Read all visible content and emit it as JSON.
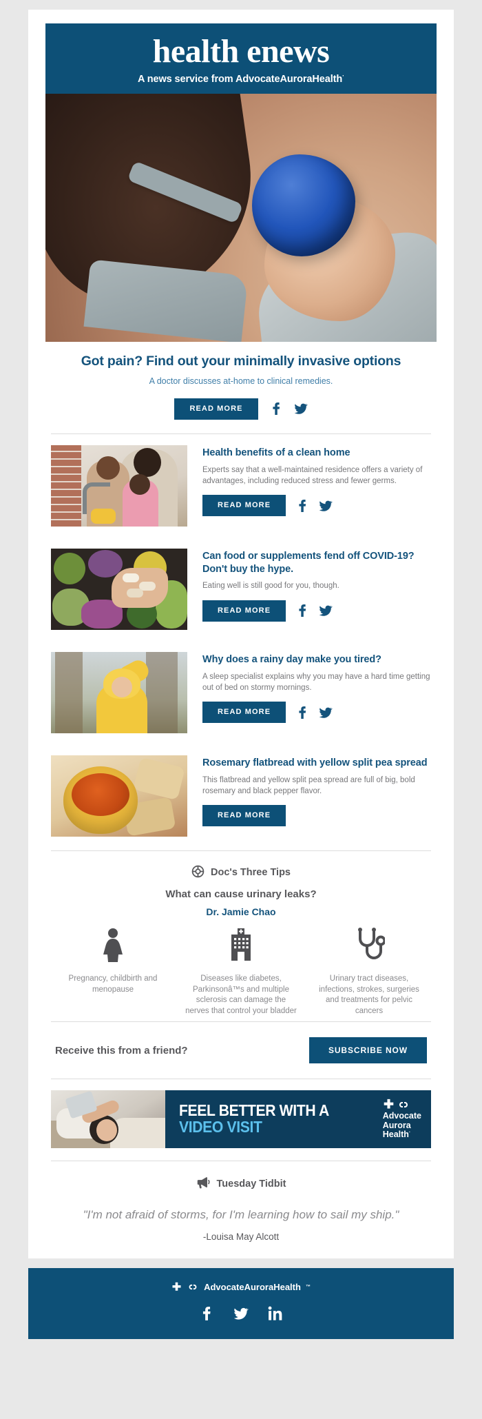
{
  "masthead": {
    "title": "health enews",
    "subtitle_prefix": "A news service from ",
    "brand": "AdvocateAuroraHealth",
    "tm": "·",
    "hero_image_alt": "woman-holding-ice-pack-to-shoulder"
  },
  "lead": {
    "title": "Got pain? Find out your minimally invasive options",
    "subtitle": "A doctor discusses at-home to clinical remedies.",
    "read_more": "READ MORE",
    "facebook": "facebook-icon",
    "twitter": "twitter-icon"
  },
  "articles": [
    {
      "title": "Health benefits of a clean home",
      "desc": "Experts say that a well-maintained residence offers a variety of advantages, including reduced stress and fewer germs.",
      "read_more": "READ MORE",
      "image_alt": "family-washing-dishes-at-kitchen-sink",
      "has_social": true
    },
    {
      "title": "Can food or supplements fend off COVID-19? Don't buy the hype.",
      "desc": "Eating well is still good for you, though.",
      "read_more": "READ MORE",
      "image_alt": "hand-holding-supplements-over-vegetables",
      "has_social": true
    },
    {
      "title": "Why does a rainy day make you tired?",
      "desc": "A sleep specialist explains why you may have a hard time getting out of bed on stormy mornings.",
      "read_more": "READ MORE",
      "image_alt": "woman-in-yellow-raincoat-in-rain",
      "has_social": true
    },
    {
      "title": "Rosemary flatbread with yellow split pea spread",
      "desc": "This flatbread and yellow split pea spread are full of big, bold rosemary and black pepper flavor.",
      "read_more": "READ MORE",
      "image_alt": "bowl-of-orange-spread-with-flatbread",
      "has_social": false
    }
  ],
  "tips": {
    "section_title": "Doc's Three Tips",
    "section_icon": "lifebuoy-icon",
    "question": "What can cause urinary leaks?",
    "doctor": "Dr. Jamie Chao",
    "items": [
      {
        "icon": "woman-figure-icon",
        "text": "Pregnancy, childbirth and menopause"
      },
      {
        "icon": "hospital-building-icon",
        "text": "Diseases like diabetes, Parkinsonâ™s and multiple sclerosis can damage the nerves that control your bladder"
      },
      {
        "icon": "stethoscope-icon",
        "text": "Urinary tract diseases, infections, strokes, surgeries and treatments for pelvic cancers"
      }
    ]
  },
  "subscribe": {
    "text": "Receive this from a friend?",
    "button": "SUBSCRIBE NOW"
  },
  "promo": {
    "line1": "FEEL BETTER WITH A",
    "line2": "VIDEO VISIT",
    "logo_line1": "Advocate",
    "logo_line2": "Aurora",
    "logo_line3": "Health",
    "logo_tm": "·",
    "image_alt": "woman-lying-in-bed-using-tablet"
  },
  "tidbit": {
    "section_title": "Tuesday Tidbit",
    "section_icon": "megaphone-icon",
    "quote": "\"I'm not afraid of storms, for I'm learning how to sail my ship.\"",
    "author": "-Louisa May Alcott"
  },
  "footer": {
    "brand": "AdvocateAuroraHealth",
    "tm": "™",
    "facebook": "facebook-icon",
    "twitter": "twitter-icon",
    "linkedin": "linkedin-icon"
  },
  "colors": {
    "brand_blue": "#0d5077",
    "link_blue": "#14537c",
    "promo_blue": "#0d3d5c",
    "promo_accent": "#5cc0ec",
    "body_gray": "#77777a",
    "heading_gray": "#58585b",
    "page_bg": "#e8e8e8"
  }
}
